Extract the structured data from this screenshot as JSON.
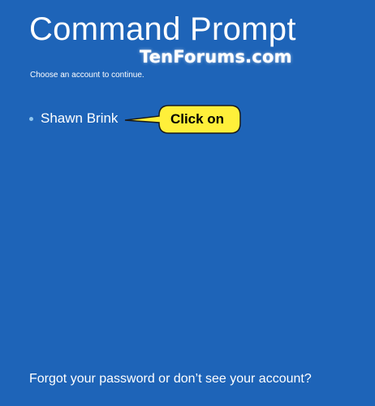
{
  "header": {
    "title": "Command Prompt",
    "subtitle": "Choose an account to continue."
  },
  "watermark": {
    "text": "TenForums.com"
  },
  "accounts": [
    {
      "name": "Shawn Brink"
    }
  ],
  "callout": {
    "text": "Click on",
    "fill_color": "#ffef3a",
    "border_color": "#1a1a1a"
  },
  "footer": {
    "forgot_link": "Forgot your password or don’t see your account?"
  },
  "colors": {
    "background": "#1e64b8",
    "text": "#ffffff",
    "bullet": "#8fc6ee"
  }
}
